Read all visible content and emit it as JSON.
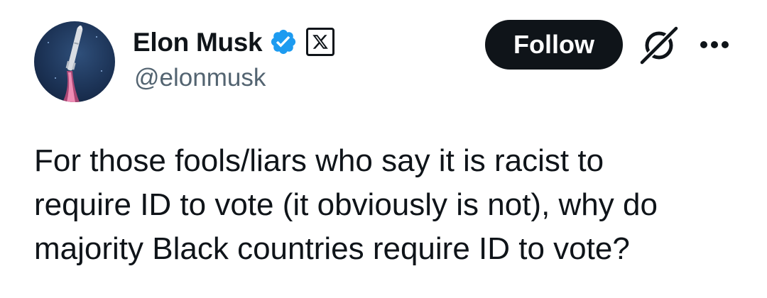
{
  "author": {
    "display_name": "Elon Musk",
    "handle": "@elonmusk",
    "verified": true,
    "affiliation_badge": "x-logo-icon",
    "avatar": "rocket-launch-avatar"
  },
  "actions": {
    "follow_label": "Follow",
    "grok_icon": "grok-icon",
    "more_icon": "more-options-icon"
  },
  "tweet": {
    "text": "For those fools/liars who say it is racist to\nrequire ID to vote (it obviously is not), why do\nmajority Black countries require ID to vote?"
  },
  "colors": {
    "text": "#0f1419",
    "secondary": "#536471",
    "verified_blue": "#1d9bf0",
    "button_bg": "#0f1419",
    "button_text": "#ffffff",
    "background": "#ffffff"
  }
}
